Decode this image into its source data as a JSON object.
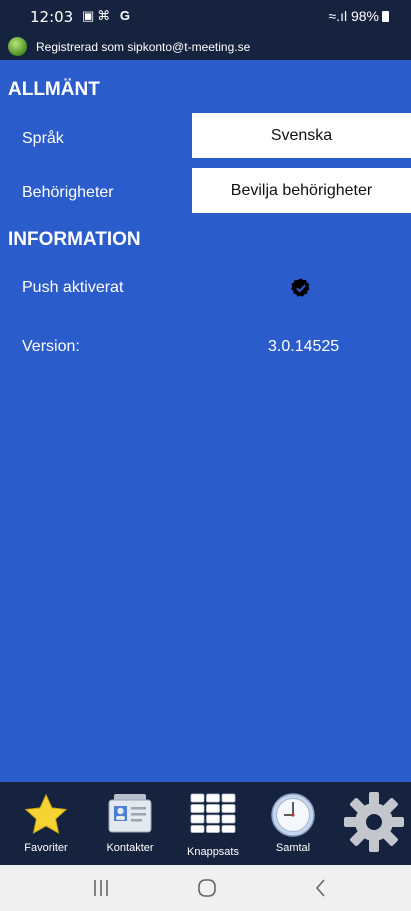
{
  "status_bar": {
    "time": "12:03",
    "right": "98%"
  },
  "registration": {
    "text": "Registrerad som sipkonto@t-meeting.se"
  },
  "general": {
    "heading": "ALLMÄNT",
    "language": {
      "label": "Språk",
      "value": "Svenska"
    },
    "permissions": {
      "label": "Behörigheter",
      "button": "Bevilja behörigheter"
    }
  },
  "information": {
    "heading": "INFORMATION",
    "push": {
      "label": "Push aktiverat",
      "icon": "verified-badge-icon"
    },
    "version": {
      "label": "Version:",
      "value": "3.0.14525"
    }
  },
  "tabs": [
    {
      "label": "Favoriter",
      "icon": "star-icon"
    },
    {
      "label": "Kontakter",
      "icon": "contact-card-icon"
    },
    {
      "label": "Knappsats",
      "icon": "keypad-icon"
    },
    {
      "label": "Samtal",
      "icon": "clock-icon"
    },
    {
      "label": "",
      "icon": "gear-icon"
    }
  ],
  "colors": {
    "main_bg": "#2b5ccc",
    "bar_bg": "#15233f",
    "star": "#f6d233"
  }
}
